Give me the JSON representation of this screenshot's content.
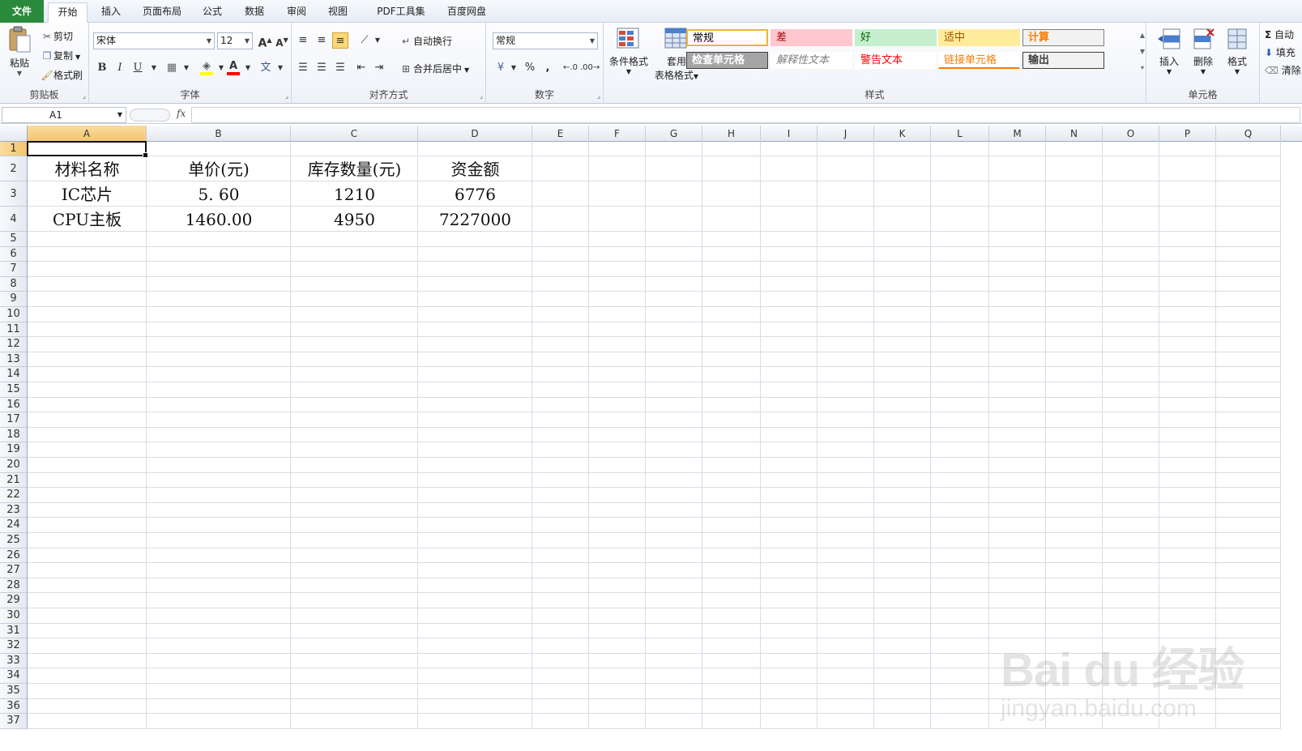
{
  "menu": {
    "file": "文件",
    "tabs": [
      "开始",
      "插入",
      "页面布局",
      "公式",
      "数据",
      "审阅",
      "视图",
      "PDF工具集",
      "百度网盘"
    ],
    "active": "开始"
  },
  "clipboard": {
    "paste": "粘贴",
    "cut": "剪切",
    "copy": "复制",
    "format_painter": "格式刷",
    "label": "剪贴板"
  },
  "font": {
    "name": "宋体",
    "size": "12",
    "label": "字体",
    "grow": "A",
    "shrink": "A",
    "bold": "B",
    "italic": "I",
    "underline": "U",
    "font_color": "A",
    "phonetic": "文"
  },
  "alignment": {
    "wrap": "自动换行",
    "merge": "合并后居中",
    "label": "对齐方式"
  },
  "number": {
    "format": "常规",
    "percent": "%",
    "comma": ",",
    "label": "数字"
  },
  "styles": {
    "conditional": "条件格式",
    "table_format_1": "套用",
    "table_format_2": "表格格式",
    "label": "样式",
    "boxes": [
      {
        "text": "常规",
        "fg": "#000000",
        "bg": "#ffffff",
        "border": "#f0b33c"
      },
      {
        "text": "差",
        "fg": "#9c0006",
        "bg": "#ffc7ce",
        "border": "#ffc7ce"
      },
      {
        "text": "好",
        "fg": "#006100",
        "bg": "#c6efce",
        "border": "#c6efce"
      },
      {
        "text": "适中",
        "fg": "#9c5700",
        "bg": "#ffeb9c",
        "border": "#ffeb9c"
      },
      {
        "text": "计算",
        "fg": "#fa7d00",
        "bg": "#f2f2f2",
        "border": "#7f7f7f"
      },
      {
        "text": "检查单元格",
        "fg": "#ffffff",
        "bg": "#a5a5a5",
        "border": "#3f3f3f"
      },
      {
        "text": "解释性文本",
        "fg": "#7f7f7f",
        "bg": "#ffffff",
        "border": "#ffffff"
      },
      {
        "text": "警告文本",
        "fg": "#ff0000",
        "bg": "#ffffff",
        "border": "#ffffff"
      },
      {
        "text": "链接单元格",
        "fg": "#fa7d00",
        "bg": "#ffffff",
        "border": "#ffffff"
      },
      {
        "text": "输出",
        "fg": "#3f3f3f",
        "bg": "#f2f2f2",
        "border": "#3f3f3f"
      }
    ]
  },
  "cells_group": {
    "insert": "插入",
    "delete": "删除",
    "format": "格式",
    "label": "单元格"
  },
  "editing": {
    "autosum": "自动",
    "fill": "填充",
    "clear": "清除"
  },
  "formula_bar": {
    "name_box": "A1",
    "fx": "fx",
    "content": ""
  },
  "sheet": {
    "columns": [
      "A",
      "B",
      "C",
      "D",
      "E",
      "F",
      "G",
      "H",
      "I",
      "J",
      "K",
      "L",
      "M",
      "N",
      "O",
      "P",
      "Q"
    ],
    "row_count": 37,
    "selected_cell": "A1",
    "rows": [
      [
        "材料名称",
        "单价(元)",
        "库存数量(元)",
        "资金额"
      ],
      [
        "IC芯片",
        "5. 60",
        "1210",
        "6776"
      ],
      [
        "CPU主板",
        "1460.00",
        "4950",
        "7227000"
      ]
    ]
  },
  "watermark": {
    "brand": "Bai du 经验",
    "url": "jingyan.baidu.com"
  }
}
